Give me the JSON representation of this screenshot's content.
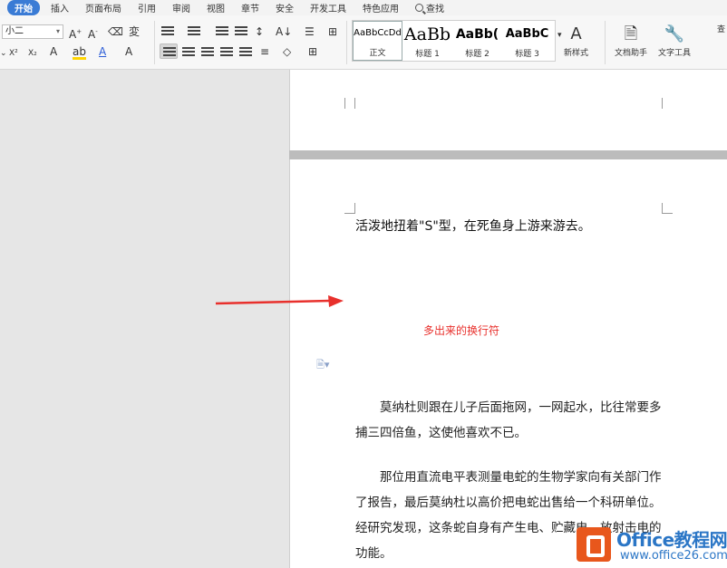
{
  "menu": {
    "items": [
      "开始",
      "插入",
      "页面布局",
      "引用",
      "审阅",
      "视图",
      "章节",
      "安全",
      "开发工具",
      "特色应用"
    ],
    "search_label": "查找"
  },
  "ribbon": {
    "font_size": "小二",
    "styles": [
      {
        "sample": "AaBbCcDd",
        "name": "正文"
      },
      {
        "sample": "AaBb",
        "name": "标题 1"
      },
      {
        "sample": "AaBb(",
        "name": "标题 2"
      },
      {
        "sample": "AaBbC",
        "name": "标题 3"
      }
    ],
    "new_style": "新样式",
    "doc_helper": "文档助手",
    "text_tools": "文字工具",
    "cut_off": "查"
  },
  "document": {
    "line1": "活泼地扭着\"S\"型，在死鱼身上游来游去。",
    "annotation": "多出来的换行符",
    "para1": "莫纳杜则跟在儿子后面拖网，一网起水，比往常要多捕三四倍鱼，这使他喜欢不已。",
    "para2": "那位用直流电平表测量电蛇的生物学家向有关部门作了报告，最后莫纳杜以高价把电蛇出售给一个科研单位。经研究发现，这条蛇自身有产生电、贮藏电、放射击电的功能。"
  },
  "watermark": {
    "title": "Office教程网",
    "url": "www.office26.com"
  },
  "colors": {
    "active_tab": "#3a7bd5",
    "annotation": "#e8302c",
    "arrow": "#e8302c",
    "watermark_logo": "#e8571c",
    "watermark_text": "#2b76c6"
  }
}
